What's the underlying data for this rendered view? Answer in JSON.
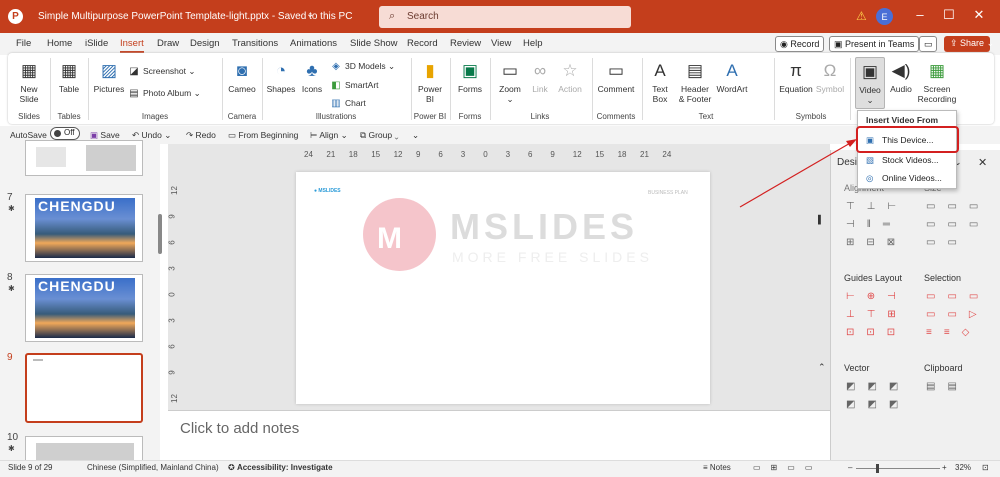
{
  "titlebar": {
    "title": "Simple Multipurpose PowerPoint Template-light.pptx  -  Saved to this PC",
    "caret": "⌄",
    "search": "Search",
    "avatar": "E"
  },
  "menubar": {
    "items": [
      "File",
      "Home",
      "iSlide",
      "Insert",
      "Draw",
      "Design",
      "Transitions",
      "Animations",
      "Slide Show",
      "Record",
      "Review",
      "View",
      "Help"
    ],
    "record": "Record",
    "present": "Present in Teams",
    "share": "Share"
  },
  "ribbon": {
    "new_slide": "New\nSlide",
    "table": "Table",
    "pictures": "Pictures",
    "screenshot": "Screenshot",
    "photo_album": "Photo Album",
    "cameo": "Cameo",
    "shapes": "Shapes",
    "icons": "Icons",
    "models_3d": "3D Models",
    "smartart": "SmartArt",
    "chart": "Chart",
    "power_bi": "Power\nBI",
    "forms": "Forms",
    "zoom": "Zoom",
    "link": "Link",
    "action": "Action",
    "comment": "Comment",
    "text_box": "Text\nBox",
    "header_footer": "Header\n& Footer",
    "wordart": "WordArt",
    "equation": "Equation",
    "symbol": "Symbol",
    "video": "Video",
    "audio": "Audio",
    "screen_recording": "Screen\nRecording",
    "groups": {
      "slides": "Slides",
      "tables": "Tables",
      "images": "Images",
      "camera": "Camera",
      "illustrations": "Illustrations",
      "power_bi": "Power BI",
      "forms": "Forms",
      "links": "Links",
      "comments": "Comments",
      "text": "Text",
      "symbols": "Symbols"
    }
  },
  "qat": {
    "autosave": "AutoSave",
    "off": "Off",
    "save": "Save",
    "undo": "Undo",
    "redo": "Redo",
    "from_beginning": "From Beginning",
    "align": "Align",
    "group": "Group"
  },
  "slides_panel": {
    "slides": [
      {
        "num": "7",
        "title": "CHENGDU"
      },
      {
        "num": "8",
        "title": "CHENGDU"
      },
      {
        "num": "9"
      },
      {
        "num": "10"
      }
    ]
  },
  "ruler": {
    "h": [
      "24",
      "21",
      "18",
      "15",
      "12",
      "9",
      "6",
      "3",
      "0",
      "3",
      "6",
      "9",
      "12",
      "15",
      "18",
      "21",
      "24"
    ],
    "v": [
      "12",
      "9",
      "6",
      "3",
      "0",
      "3",
      "6",
      "9",
      "12"
    ]
  },
  "slide": {
    "logo": "MSLIDES",
    "watermark": "MSLIDES",
    "watermark_sub": "MORE FREE SLIDES",
    "header_right": "BUSINESS PLAN"
  },
  "notes": {
    "placeholder": "Click to add notes"
  },
  "design_panel": {
    "title": "Desi",
    "alignment": "Alignment",
    "size": "Size",
    "guides": "Guides Layout",
    "selection": "Selection",
    "vector": "Vector",
    "clipboard": "Clipboard"
  },
  "dropdown": {
    "title": "Insert Video From",
    "items": [
      "This Device...",
      "Stock Videos...",
      "Online Videos..."
    ]
  },
  "status": {
    "slide": "Slide 9 of 29",
    "lang": "Chinese (Simplified, Mainland China)",
    "accessibility": "Accessibility: Investigate",
    "notes": "Notes",
    "zoom": "32%"
  },
  "colors": {
    "accent": "#c43e1c",
    "highlight": "#d32020"
  }
}
